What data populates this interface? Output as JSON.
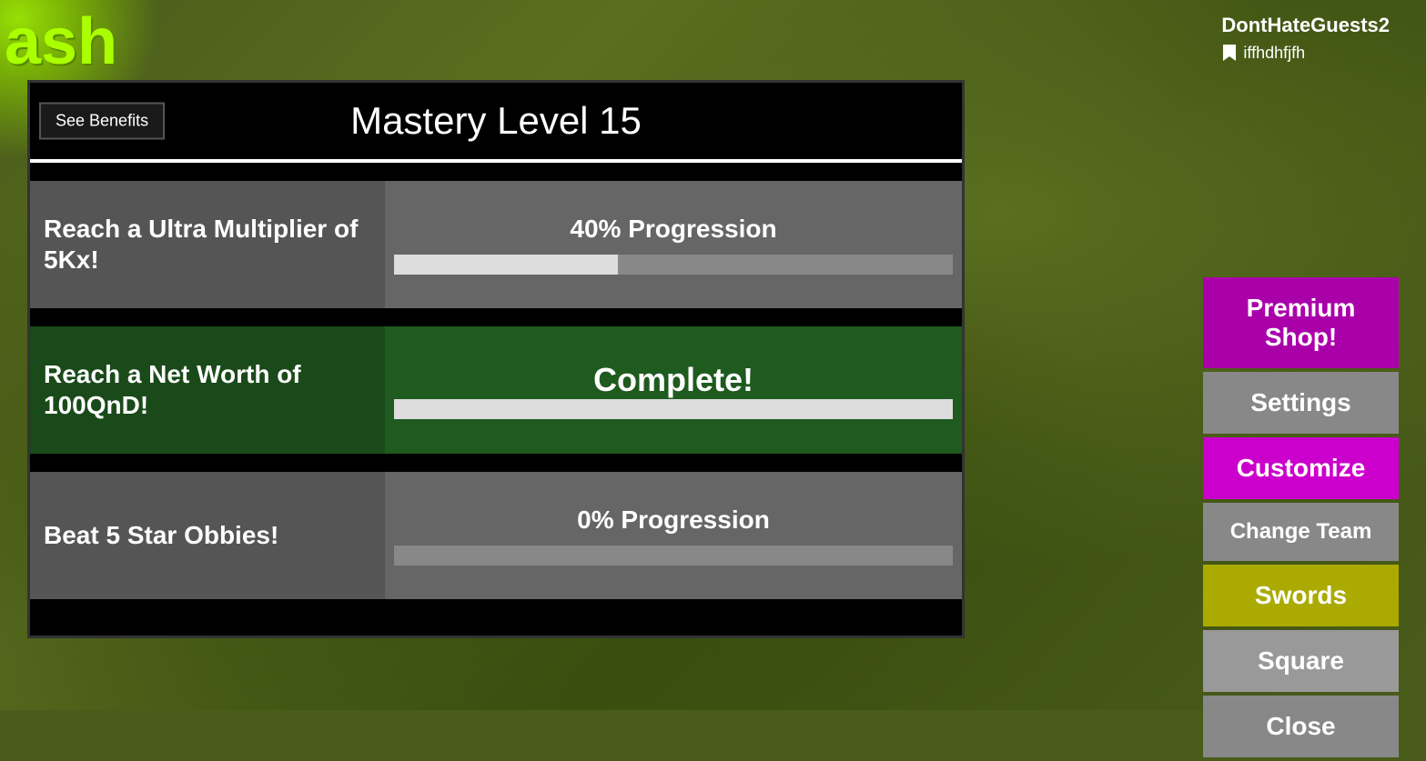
{
  "background": {
    "color": "#4a5c1a"
  },
  "user": {
    "username": "DontHateGuests2",
    "id": "iffhdhfjfh"
  },
  "splash": {
    "text": "ash"
  },
  "mastery": {
    "title": "Mastery Level 15",
    "see_benefits_label": "See Benefits",
    "tasks": [
      {
        "label": "Reach a Ultra Multiplier of 5Kx!",
        "status": "progress",
        "progress_text": "40% Progression",
        "progress_percent": 40
      },
      {
        "label": "Reach a Net Worth of 100QnD!",
        "status": "complete",
        "progress_text": "Complete!",
        "progress_percent": 100
      },
      {
        "label": "Beat 5 Star Obbies!",
        "status": "progress",
        "progress_text": "0% Progression",
        "progress_percent": 0
      }
    ]
  },
  "buttons": {
    "premium_shop": "Premium Shop!",
    "settings": "Settings",
    "customize": "Customize",
    "change_team": "Change Team",
    "swords": "Swords",
    "square": "Square",
    "close": "Close"
  }
}
